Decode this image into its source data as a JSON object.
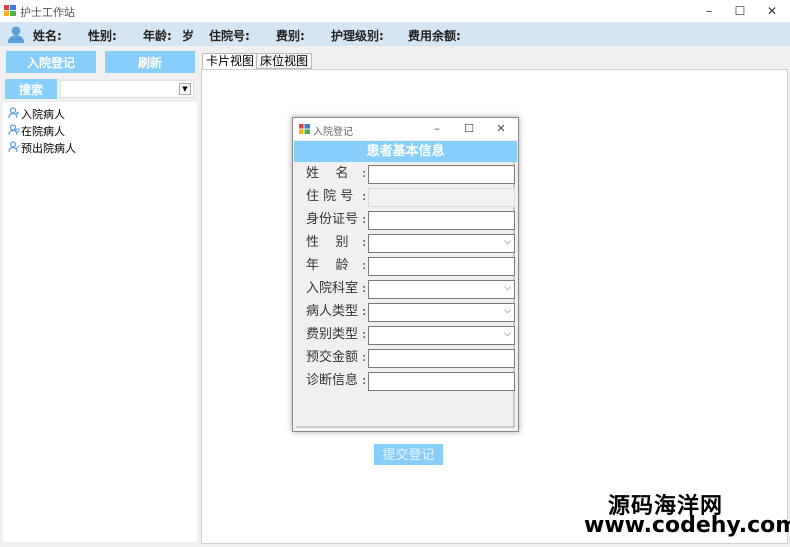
{
  "window": {
    "title": "护士工作站",
    "minimize": "–",
    "maximize": "☐",
    "close": "✕"
  },
  "infobar": {
    "name_label": "姓名:",
    "gender_label": "性别:",
    "age_label": "年龄:",
    "age_unit": "岁",
    "admission_no_label": "住院号:",
    "fee_label": "费别:",
    "care_level_label": "护理级别:",
    "balance_label": "费用余额:"
  },
  "toolbar": {
    "admission_button": "入院登记",
    "refresh_button": "刷新",
    "search_button": "搜索"
  },
  "tree": {
    "items": [
      {
        "label": "入院病人"
      },
      {
        "label": "在院病人"
      },
      {
        "label": "预出院病人"
      }
    ]
  },
  "tabs": [
    {
      "label": "卡片视图",
      "active": true
    },
    {
      "label": "床位视图",
      "active": false
    }
  ],
  "dialog": {
    "title": "入院登记",
    "header": "患者基本信息",
    "fields": [
      {
        "label": "姓    名",
        "type": "text",
        "value": ""
      },
      {
        "label": "住 院 号",
        "type": "readonly",
        "value": ""
      },
      {
        "label": "身份证号",
        "type": "text",
        "value": ""
      },
      {
        "label": "性    别",
        "type": "select",
        "value": ""
      },
      {
        "label": "年    龄",
        "type": "text",
        "value": ""
      },
      {
        "label": "入院科室",
        "type": "select",
        "value": ""
      },
      {
        "label": "病人类型",
        "type": "select",
        "value": ""
      },
      {
        "label": "费别类型",
        "type": "select",
        "value": ""
      },
      {
        "label": "预交金额",
        "type": "text",
        "value": ""
      },
      {
        "label": "诊断信息",
        "type": "text",
        "value": ""
      }
    ],
    "colon": ":",
    "submit_button": "提交登记"
  },
  "watermark": {
    "line1": "源码海洋网",
    "line2": "www.codehy.com"
  },
  "colors": {
    "accent": "#87cefa",
    "infobar_bg": "#d6e5f2"
  }
}
